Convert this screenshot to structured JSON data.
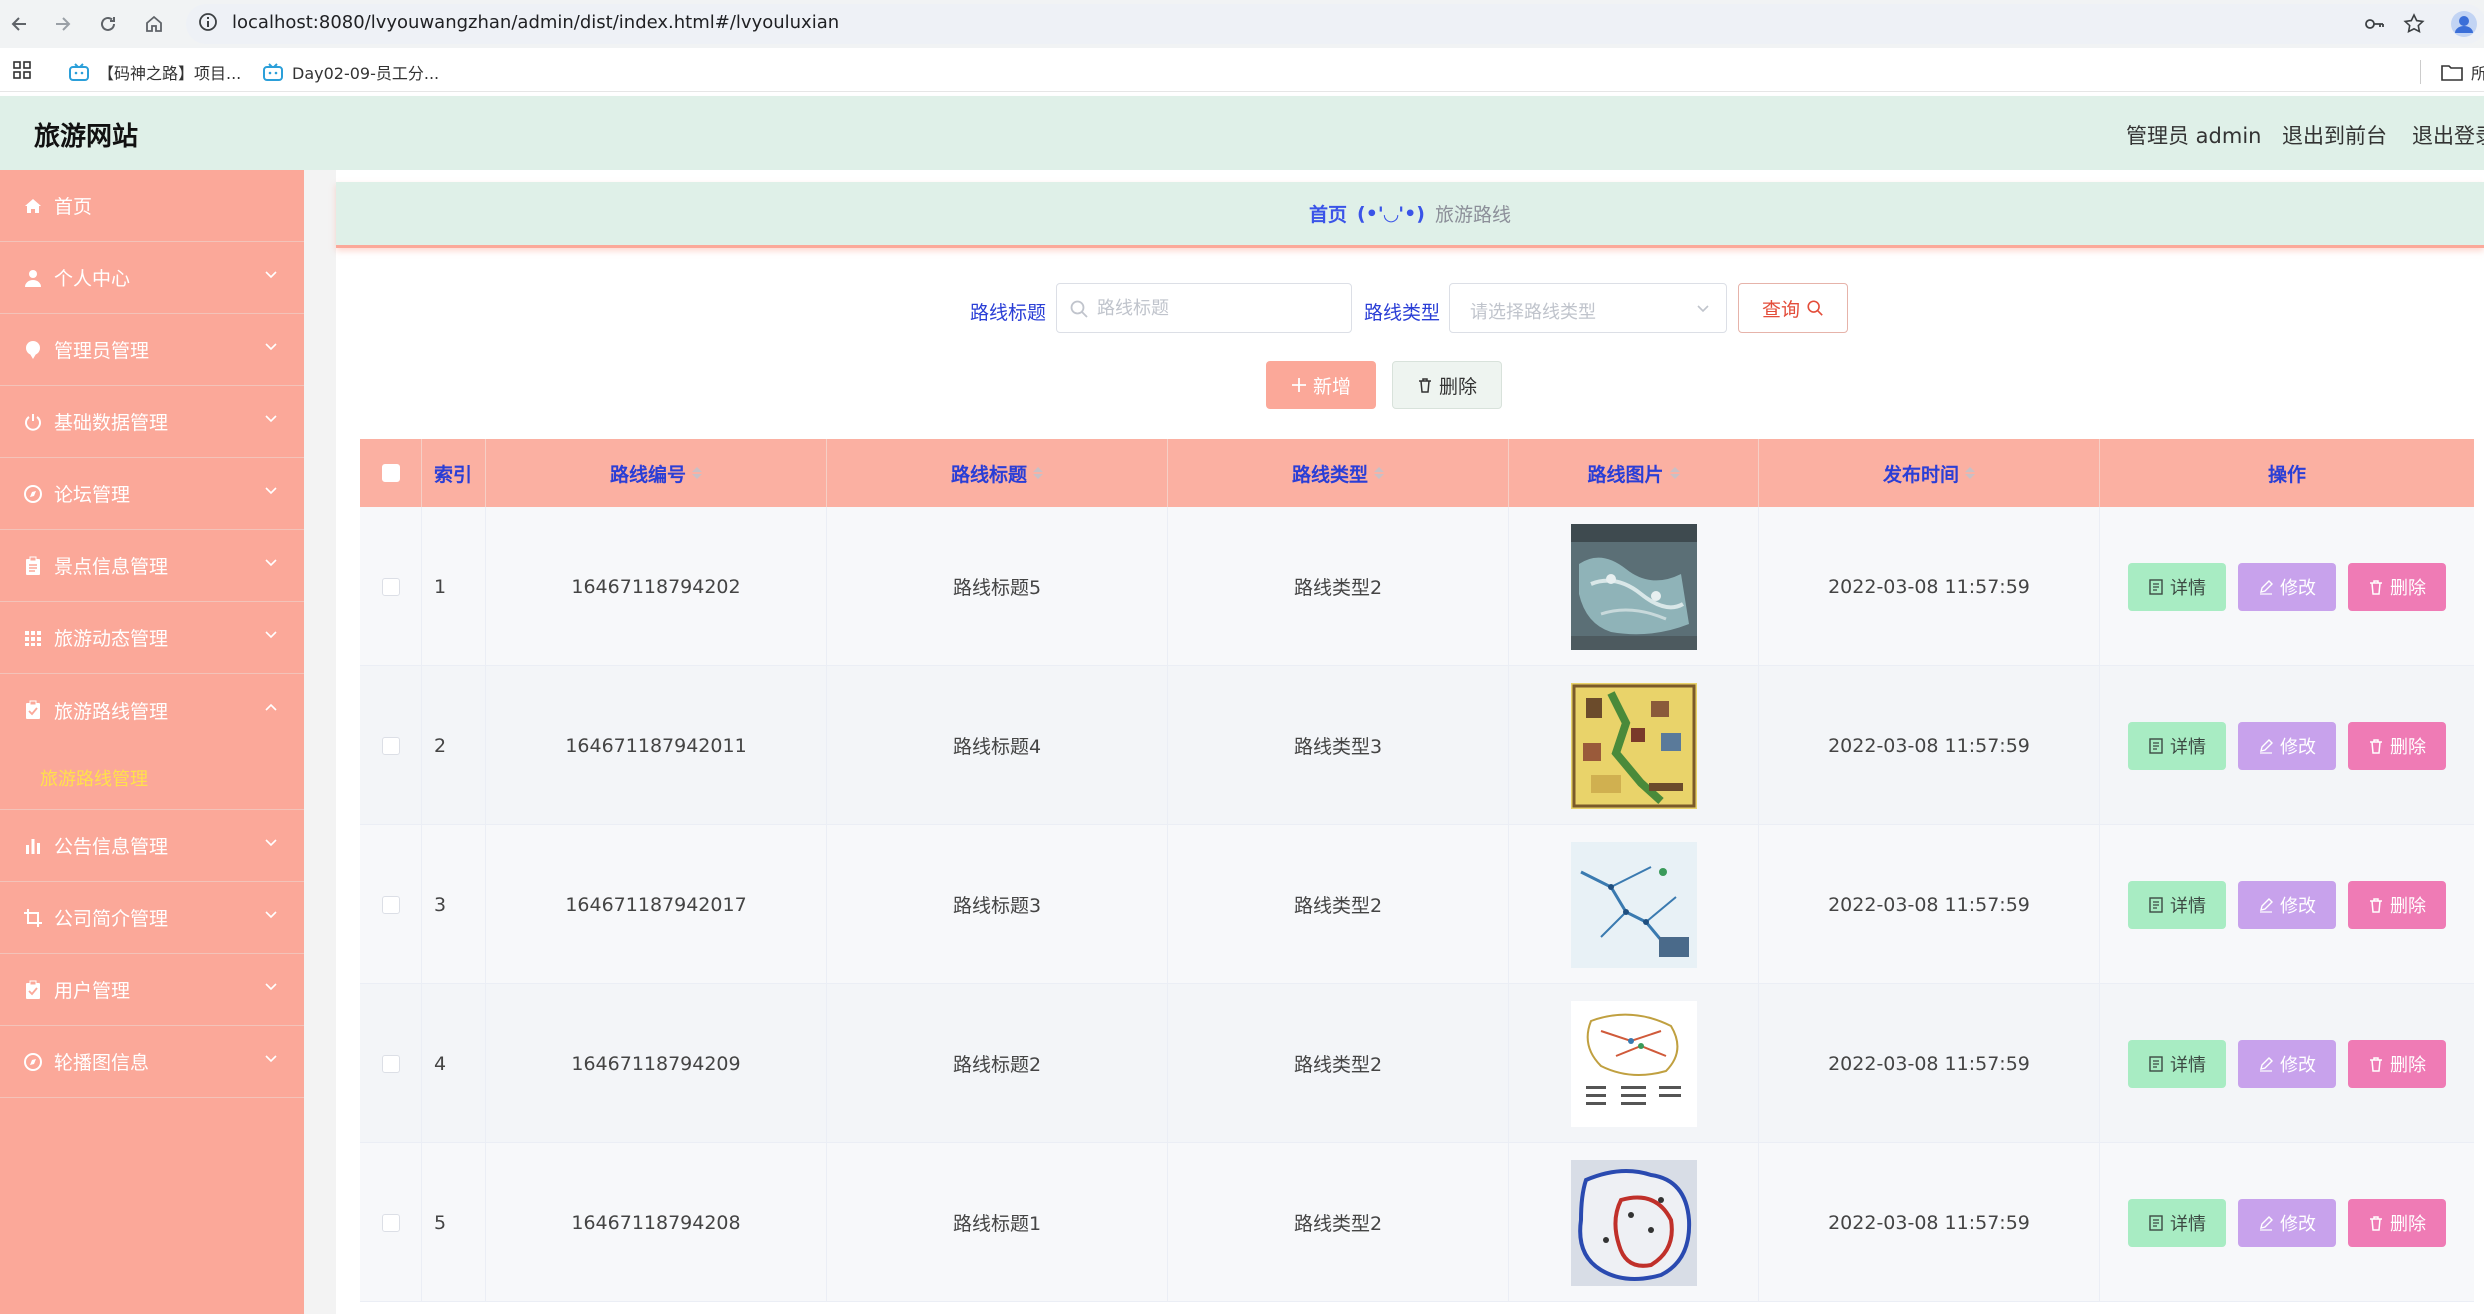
{
  "browser": {
    "url": "localhost:8080/lvyouwangzhan/admin/dist/index.html#/lvyouluxian",
    "bookmarks": [
      "【码神之路】项目...",
      "Day02-09-员工分..."
    ],
    "bookmark_right": "所"
  },
  "header": {
    "title": "旅游网站",
    "user": "管理员 admin",
    "front": "退出到前台",
    "logout": "退出登录"
  },
  "sidebar": {
    "items": [
      {
        "label": "首页",
        "icon": "home-icon"
      },
      {
        "label": "个人中心",
        "icon": "user-icon"
      },
      {
        "label": "管理员管理",
        "icon": "pin-icon"
      },
      {
        "label": "基础数据管理",
        "icon": "power-icon"
      },
      {
        "label": "论坛管理",
        "icon": "compass-icon"
      },
      {
        "label": "景点信息管理",
        "icon": "clipboard-icon"
      },
      {
        "label": "旅游动态管理",
        "icon": "grid-icon"
      },
      {
        "label": "旅游路线管理",
        "icon": "clipboard-check-icon"
      },
      {
        "label": "公告信息管理",
        "icon": "bar-chart-icon"
      },
      {
        "label": "公司简介管理",
        "icon": "crop-icon"
      },
      {
        "label": "用户管理",
        "icon": "clipboard-icon"
      },
      {
        "label": "轮播图信息",
        "icon": "compass-icon"
      }
    ],
    "submenu_active": "旅游路线管理"
  },
  "breadcrumb": {
    "home": "首页",
    "sep": "(•'◡'•)",
    "current": "旅游路线"
  },
  "search": {
    "title_label": "路线标题",
    "title_placeholder": "路线标题",
    "type_label": "路线类型",
    "type_placeholder": "请选择路线类型",
    "query": "查询",
    "add": "新增",
    "delete": "删除"
  },
  "table": {
    "headers": [
      "索引",
      "路线编号",
      "路线标题",
      "路线类型",
      "路线图片",
      "发布时间",
      "操作"
    ],
    "actions": {
      "detail": "详情",
      "edit": "修改",
      "delete": "删除"
    },
    "rows": [
      {
        "idx": "1",
        "no": "16467118794202",
        "title": "路线标题5",
        "type": "路线类型2",
        "time": "2022-03-08 11:57:59"
      },
      {
        "idx": "2",
        "no": "164671187942011",
        "title": "路线标题4",
        "type": "路线类型3",
        "time": "2022-03-08 11:57:59"
      },
      {
        "idx": "3",
        "no": "164671187942017",
        "title": "路线标题3",
        "type": "路线类型2",
        "time": "2022-03-08 11:57:59"
      },
      {
        "idx": "4",
        "no": "16467118794209",
        "title": "路线标题2",
        "type": "路线类型2",
        "time": "2022-03-08 11:57:59"
      },
      {
        "idx": "5",
        "no": "16467118794208",
        "title": "路线标题1",
        "type": "路线类型2",
        "time": "2022-03-08 11:57:59"
      }
    ]
  },
  "colors": {
    "sidebar": "#fba899",
    "header": "#dff0e8",
    "accent_blue": "#2a3ed6",
    "detail": "#a8ecc3",
    "edit": "#c8a2ec",
    "delete": "#ef7bb5"
  }
}
